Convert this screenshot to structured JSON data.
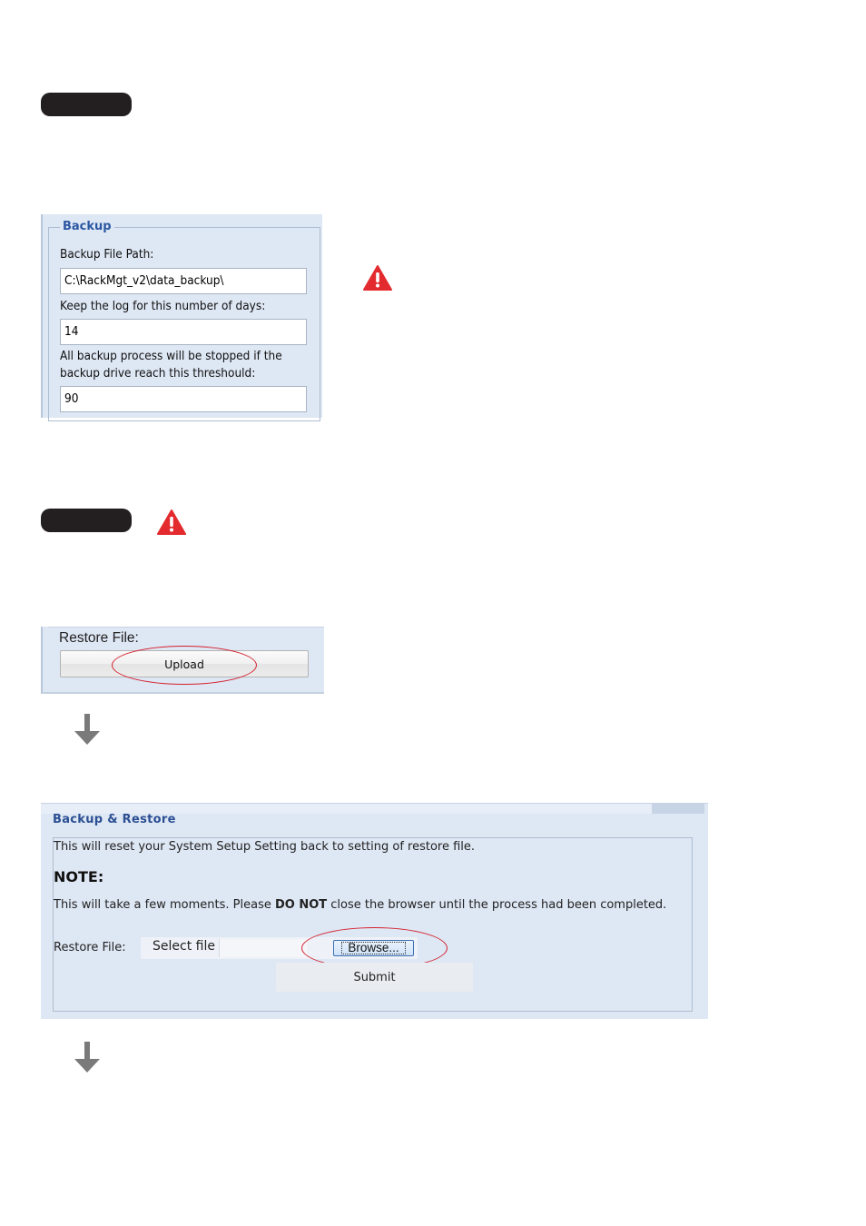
{
  "backup": {
    "legend": "Backup",
    "file_path_label": "Backup File Path:",
    "file_path_value": "C:\\RackMgt_v2\\data_backup\\",
    "keep_days_label": "Keep the log for this number of days:",
    "keep_days_value": "14",
    "threshold_label_line1": "All backup process will be stopped if the",
    "threshold_label_line2": "backup drive reach this threshould:",
    "threshold_value": "90"
  },
  "restore_small": {
    "label": "Restore File:",
    "upload_label": "Upload"
  },
  "backup_restore": {
    "legend": "Backup & Restore",
    "reset_text": "This will reset your System Setup Setting back to setting of restore file.",
    "note_heading": "NOTE:",
    "note_text_before": "This will take a few moments. Please ",
    "note_text_bold": "DO NOT",
    "note_text_after": " close the browser until the process had been completed.",
    "restore_file_label": "Restore File:",
    "select_file_text": "Select file",
    "browse_label": "Browse...",
    "submit_label": "Submit"
  },
  "colors": {
    "warning_red": "#e32b2f",
    "highlight_ring": "#d5202e",
    "panel_bg": "#dee7f4",
    "legend_blue": "#2b57a2",
    "pill_black": "#231f20",
    "arrow_gray": "#7a7a7a"
  },
  "icons": [
    "warning-triangle-icon",
    "down-arrow-icon"
  ]
}
